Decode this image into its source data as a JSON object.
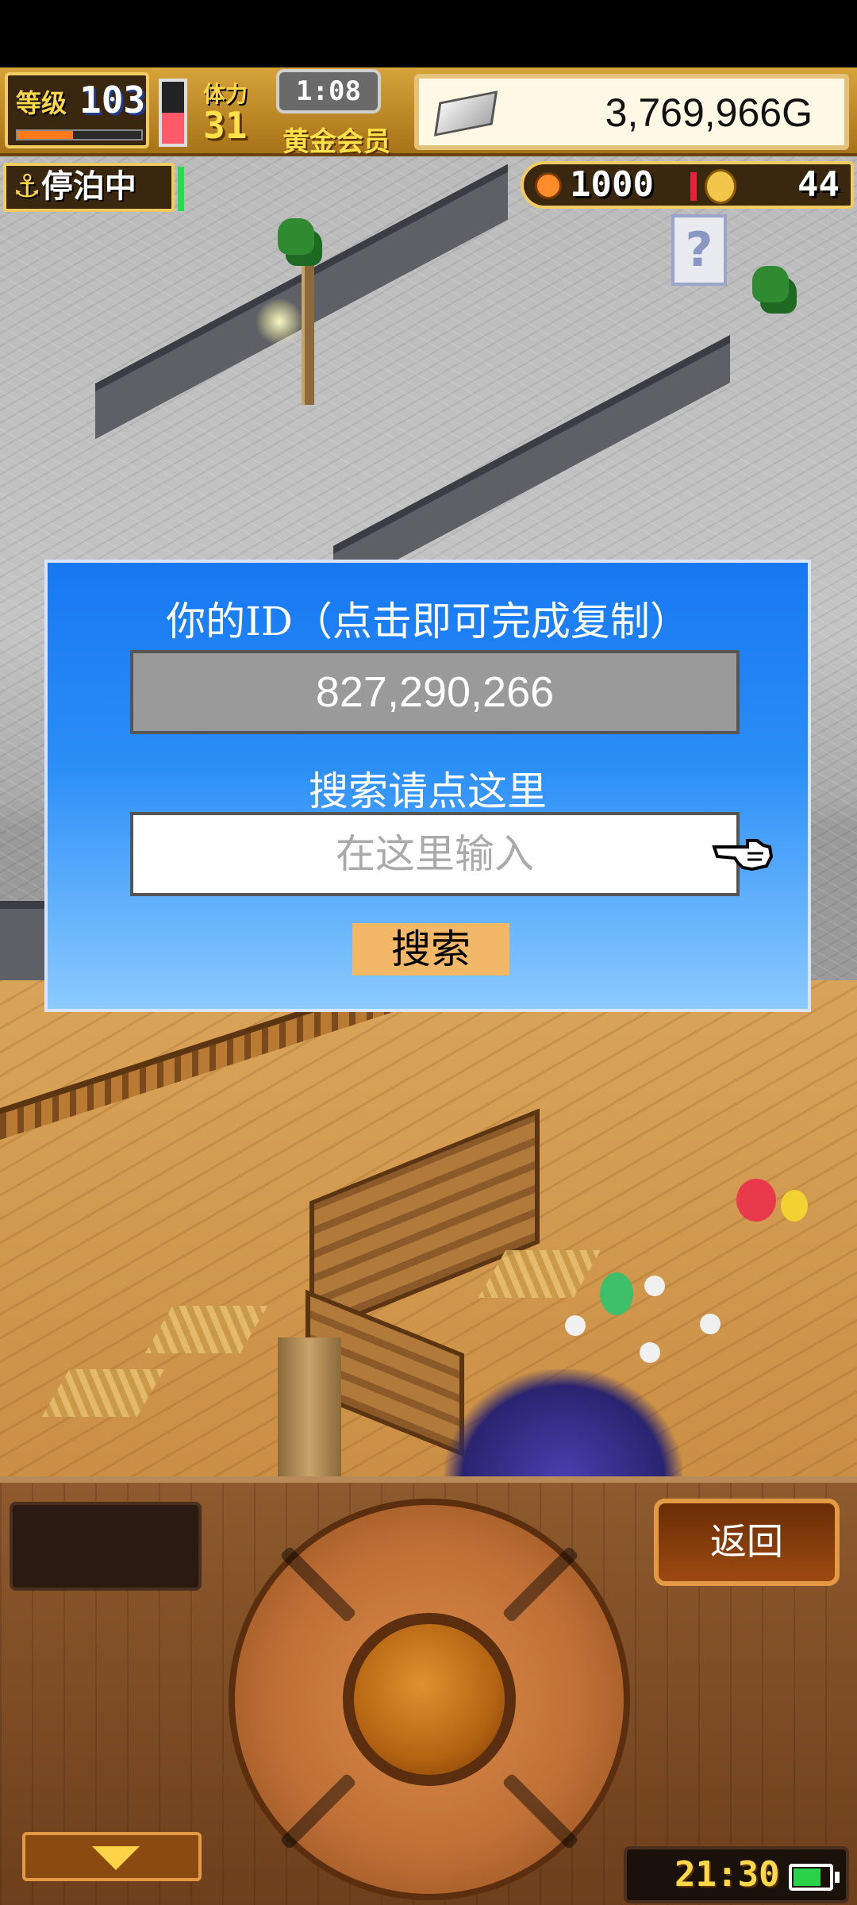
{
  "hud": {
    "level_label": "等级",
    "level_value": "103",
    "level_progress": 0.45,
    "stamina_label": "体力",
    "stamina_value": "31",
    "stamina_level": 0.5,
    "timer": "1:08",
    "membership": "黄金会员",
    "gold": "3,769,966G",
    "status": "停泊中",
    "medals": "1000",
    "coins": "44"
  },
  "dialog": {
    "id_title": "你的ID（点击即可完成复制）",
    "player_id": "827,290,266",
    "search_title": "搜索请点这里",
    "search_placeholder": "在这里输入",
    "search_button": "搜索"
  },
  "controls": {
    "back_label": "返回",
    "clock": "21:30",
    "battery_level": 0.8
  },
  "colors": {
    "dialog_top": "#1778f2",
    "dialog_bottom": "#8bcaff",
    "search_button": "#f2b868",
    "gold_panel": "#fff8e4"
  },
  "icons": [
    "anchor-icon",
    "silver-ingot-icon",
    "fish-icon",
    "coin-icon",
    "pointing-hand-icon",
    "down-arrow-icon",
    "battery-icon"
  ]
}
